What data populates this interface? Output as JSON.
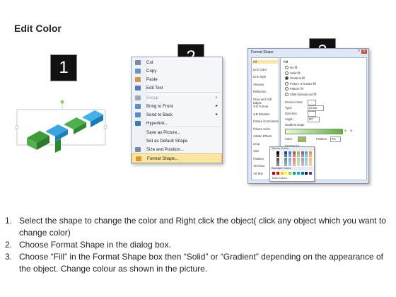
{
  "page_title": "Edit Color",
  "badges": [
    "1",
    "2",
    "3"
  ],
  "context_menu": {
    "items": [
      {
        "label": "Cut",
        "icon": "scissors-icon",
        "color": "#7a8aa3"
      },
      {
        "label": "Copy",
        "icon": "copy-icon",
        "color": "#6d8fc9"
      },
      {
        "label": "Paste",
        "icon": "paste-icon",
        "color": "#c99b4a"
      },
      {
        "label": "Edit Text",
        "icon": "edit-text-icon",
        "color": "#5a7ab8"
      },
      {
        "label": "Group",
        "icon": "group-icon",
        "color": "#a0a8b4",
        "submenu": true,
        "disabled": true
      },
      {
        "label": "Bring to Front",
        "icon": "bring-front-icon",
        "color": "#5b8cc9",
        "submenu": true
      },
      {
        "label": "Send to Back",
        "icon": "send-back-icon",
        "color": "#5b8cc9",
        "submenu": true
      },
      {
        "label": "Hyperlink...",
        "icon": "hyperlink-icon",
        "color": "#3b7bb0"
      },
      {
        "label": "Save as Picture...",
        "icon": "",
        "color": ""
      },
      {
        "label": "Set as Default Shape",
        "icon": "",
        "color": ""
      },
      {
        "label": "Size and Position...",
        "icon": "size-position-icon",
        "color": "#7a8aa3"
      },
      {
        "label": "Format Shape...",
        "icon": "format-shape-icon",
        "color": "#d89a2a",
        "highlighted": true
      }
    ]
  },
  "dialog": {
    "title": "Format Shape",
    "help": "?",
    "close": "X",
    "categories": [
      "Fill",
      "Line Color",
      "Line Style",
      "Shadow",
      "Reflection",
      "Glow and Soft Edges",
      "3-D Format",
      "3-D Rotation",
      "Picture Corrections",
      "Picture Color",
      "Artistic Effects",
      "Crop",
      "Size",
      "Position",
      "Text Box",
      "Alt Text"
    ],
    "selected_category": "Fill",
    "fill_heading": "Fill",
    "fill_options": [
      {
        "label": "No fill",
        "on": false
      },
      {
        "label": "Solid fill",
        "on": false
      },
      {
        "label": "Gradient fill",
        "on": true
      },
      {
        "label": "Picture or texture fill",
        "on": false
      },
      {
        "label": "Pattern fill",
        "on": false
      },
      {
        "label": "Slide background fill",
        "on": false
      }
    ],
    "preset_colors_label": "Preset colors:",
    "type_label": "Type:",
    "type_value": "Linear",
    "direction_label": "Direction:",
    "angle_label": "Angle:",
    "angle_value": "90°",
    "gradient_stops_label": "Gradient stops",
    "color_label": "Color",
    "position_label": "Position:",
    "position_value": "0%",
    "brightness_label": "Brightness:",
    "transparency_label": "Transparency:",
    "rotate_label": "Rotate with shape",
    "palette": {
      "theme_heading": "Theme Colors",
      "standard_heading": "Standard Colors",
      "more_colors": "More Colors...",
      "theme_row": [
        "#ffffff",
        "#000000",
        "#eeece1",
        "#1f497d",
        "#4f81bd",
        "#c0504d",
        "#9bbb59",
        "#8064a2",
        "#4bacc6",
        "#f79646"
      ],
      "standard_row": [
        "#c00000",
        "#ff0000",
        "#ffc000",
        "#ffff00",
        "#92d050",
        "#00b050",
        "#00b0f0",
        "#0070c0",
        "#002060",
        "#7030a0"
      ]
    }
  },
  "instructions": [
    {
      "num": "1.",
      "text": "Select the shape to change the color and Right click the object( click any object which you want to change color)"
    },
    {
      "num": "2.",
      "text": "Choose Format Shape in the dialog box."
    },
    {
      "num": "3.",
      "text": "Choose “Fill” in the Format Shape box then “Solid” or “Gradient” depending on the appearance of the object. Change colour as shown in the picture."
    }
  ]
}
